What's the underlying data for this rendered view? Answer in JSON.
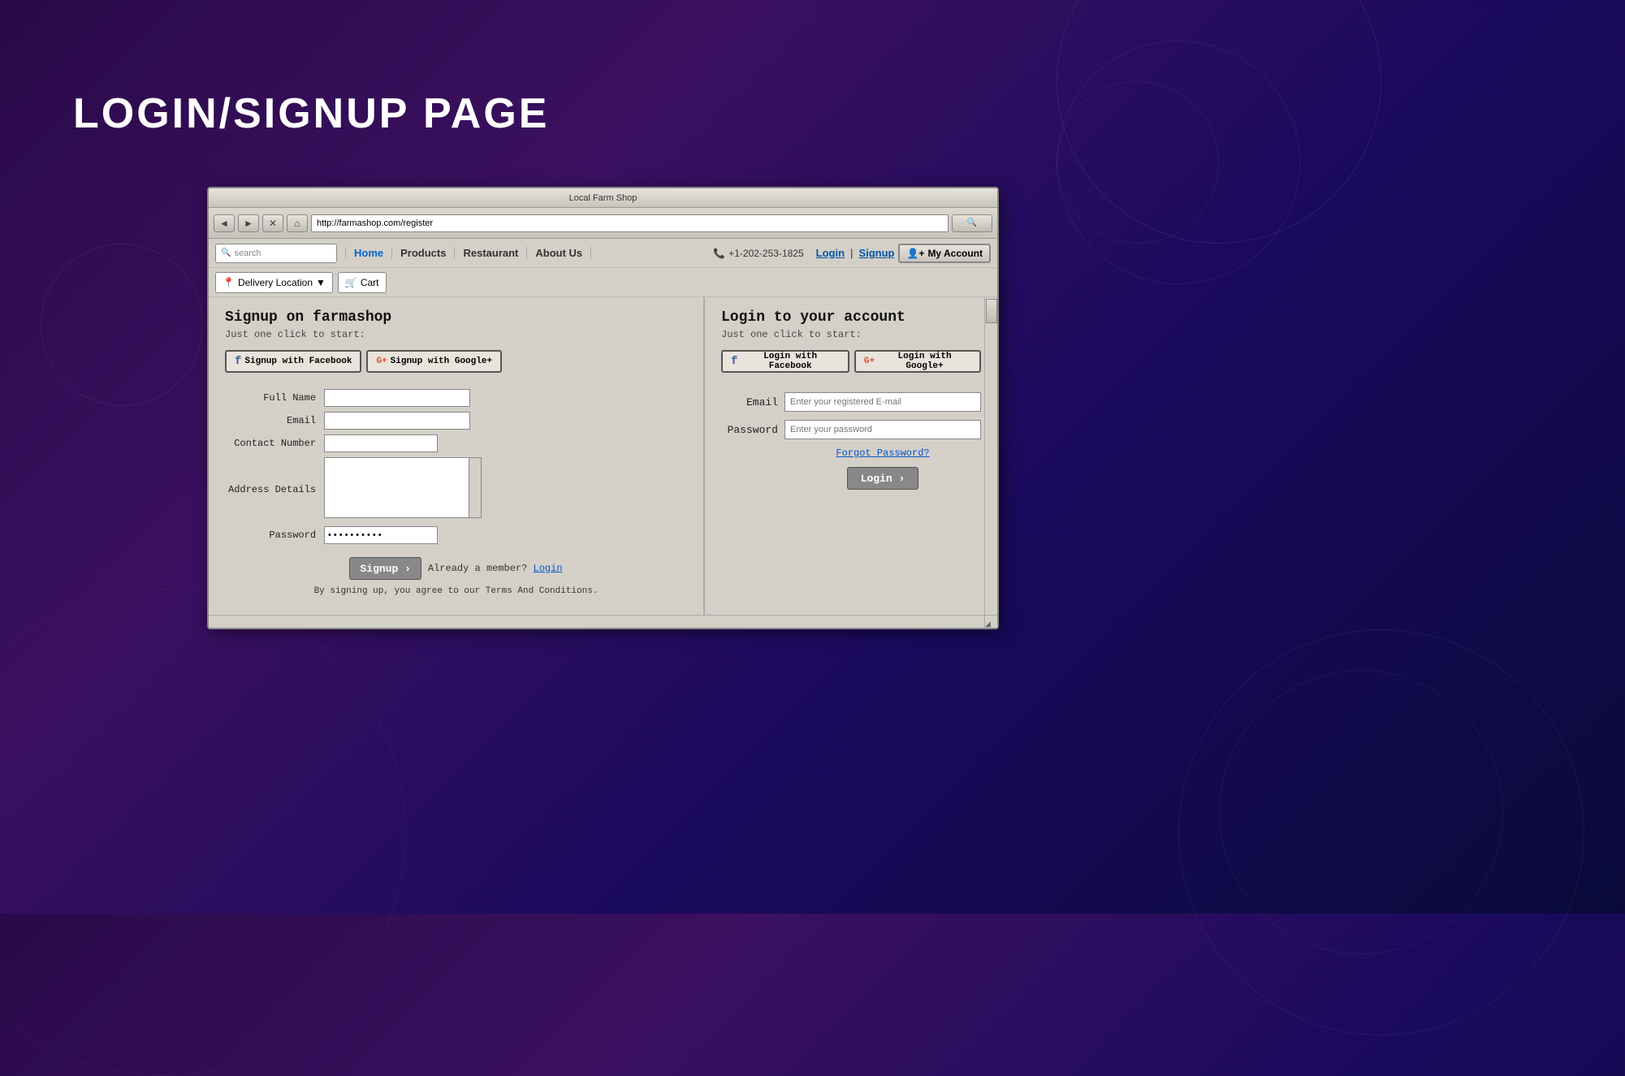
{
  "page": {
    "title": "LOGIN/SIGNUP PAGE",
    "background_note": "dark purple gradient with decorative circles"
  },
  "browser": {
    "title": "Local Farm Shop",
    "url": "http://farmashop.com/register",
    "nav_back": "◄",
    "nav_forward": "►",
    "nav_close": "✕",
    "nav_home": "⌂",
    "search_placeholder": "search"
  },
  "nav": {
    "links": [
      {
        "label": "Home",
        "active": false
      },
      {
        "label": "Products",
        "active": false
      },
      {
        "label": "Restaurant",
        "active": false
      },
      {
        "label": "About Us",
        "active": false
      }
    ],
    "phone": "+1-202-253-1825",
    "phone_icon": "📞",
    "login_label": "Login",
    "signup_label": "Signup",
    "my_account_label": "My Account",
    "my_account_icon": "👤",
    "delivery_label": "Delivery Location",
    "delivery_icon": "📍",
    "delivery_dropdown": "▼",
    "cart_label": "Cart",
    "cart_icon": "🛒"
  },
  "signup": {
    "title": "Signup on farmashop",
    "subtitle": "Just one click to start:",
    "facebook_btn": "Signup with Facebook",
    "facebook_icon": "f",
    "google_btn": "Signup with Google+",
    "google_icon": "G+",
    "fields": {
      "full_name_label": "Full Name",
      "email_label": "Email",
      "contact_label": "Contact Number",
      "address_label": "Address Details",
      "password_label": "Password",
      "password_value": "••••••••••"
    },
    "signup_btn": "Signup ›",
    "already_member_text": "Already a member?",
    "login_link": "Login",
    "terms_text": "By signing up, you agree to our Terms And Conditions."
  },
  "login": {
    "title": "Login to your account",
    "subtitle": "Just one click to start:",
    "facebook_btn": "Login with Facebook",
    "facebook_icon": "f",
    "google_btn": "Login with Google+",
    "google_icon": "G+",
    "email_label": "Email",
    "email_placeholder": "Enter your registered E-mail",
    "password_label": "Password",
    "password_placeholder": "Enter your password",
    "forgot_label": "Forgot Password?",
    "login_btn": "Login ›"
  }
}
